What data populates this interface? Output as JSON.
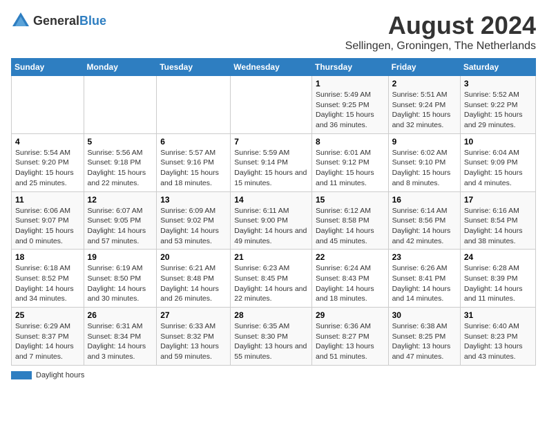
{
  "logo": {
    "general": "General",
    "blue": "Blue"
  },
  "title": "August 2024",
  "subtitle": "Sellingen, Groningen, The Netherlands",
  "days_of_week": [
    "Sunday",
    "Monday",
    "Tuesday",
    "Wednesday",
    "Thursday",
    "Friday",
    "Saturday"
  ],
  "weeks": [
    [
      {
        "num": "",
        "info": ""
      },
      {
        "num": "",
        "info": ""
      },
      {
        "num": "",
        "info": ""
      },
      {
        "num": "",
        "info": ""
      },
      {
        "num": "1",
        "info": "Sunrise: 5:49 AM\nSunset: 9:25 PM\nDaylight: 15 hours and 36 minutes."
      },
      {
        "num": "2",
        "info": "Sunrise: 5:51 AM\nSunset: 9:24 PM\nDaylight: 15 hours and 32 minutes."
      },
      {
        "num": "3",
        "info": "Sunrise: 5:52 AM\nSunset: 9:22 PM\nDaylight: 15 hours and 29 minutes."
      }
    ],
    [
      {
        "num": "4",
        "info": "Sunrise: 5:54 AM\nSunset: 9:20 PM\nDaylight: 15 hours and 25 minutes."
      },
      {
        "num": "5",
        "info": "Sunrise: 5:56 AM\nSunset: 9:18 PM\nDaylight: 15 hours and 22 minutes."
      },
      {
        "num": "6",
        "info": "Sunrise: 5:57 AM\nSunset: 9:16 PM\nDaylight: 15 hours and 18 minutes."
      },
      {
        "num": "7",
        "info": "Sunrise: 5:59 AM\nSunset: 9:14 PM\nDaylight: 15 hours and 15 minutes."
      },
      {
        "num": "8",
        "info": "Sunrise: 6:01 AM\nSunset: 9:12 PM\nDaylight: 15 hours and 11 minutes."
      },
      {
        "num": "9",
        "info": "Sunrise: 6:02 AM\nSunset: 9:10 PM\nDaylight: 15 hours and 8 minutes."
      },
      {
        "num": "10",
        "info": "Sunrise: 6:04 AM\nSunset: 9:09 PM\nDaylight: 15 hours and 4 minutes."
      }
    ],
    [
      {
        "num": "11",
        "info": "Sunrise: 6:06 AM\nSunset: 9:07 PM\nDaylight: 15 hours and 0 minutes."
      },
      {
        "num": "12",
        "info": "Sunrise: 6:07 AM\nSunset: 9:05 PM\nDaylight: 14 hours and 57 minutes."
      },
      {
        "num": "13",
        "info": "Sunrise: 6:09 AM\nSunset: 9:02 PM\nDaylight: 14 hours and 53 minutes."
      },
      {
        "num": "14",
        "info": "Sunrise: 6:11 AM\nSunset: 9:00 PM\nDaylight: 14 hours and 49 minutes."
      },
      {
        "num": "15",
        "info": "Sunrise: 6:12 AM\nSunset: 8:58 PM\nDaylight: 14 hours and 45 minutes."
      },
      {
        "num": "16",
        "info": "Sunrise: 6:14 AM\nSunset: 8:56 PM\nDaylight: 14 hours and 42 minutes."
      },
      {
        "num": "17",
        "info": "Sunrise: 6:16 AM\nSunset: 8:54 PM\nDaylight: 14 hours and 38 minutes."
      }
    ],
    [
      {
        "num": "18",
        "info": "Sunrise: 6:18 AM\nSunset: 8:52 PM\nDaylight: 14 hours and 34 minutes."
      },
      {
        "num": "19",
        "info": "Sunrise: 6:19 AM\nSunset: 8:50 PM\nDaylight: 14 hours and 30 minutes."
      },
      {
        "num": "20",
        "info": "Sunrise: 6:21 AM\nSunset: 8:48 PM\nDaylight: 14 hours and 26 minutes."
      },
      {
        "num": "21",
        "info": "Sunrise: 6:23 AM\nSunset: 8:45 PM\nDaylight: 14 hours and 22 minutes."
      },
      {
        "num": "22",
        "info": "Sunrise: 6:24 AM\nSunset: 8:43 PM\nDaylight: 14 hours and 18 minutes."
      },
      {
        "num": "23",
        "info": "Sunrise: 6:26 AM\nSunset: 8:41 PM\nDaylight: 14 hours and 14 minutes."
      },
      {
        "num": "24",
        "info": "Sunrise: 6:28 AM\nSunset: 8:39 PM\nDaylight: 14 hours and 11 minutes."
      }
    ],
    [
      {
        "num": "25",
        "info": "Sunrise: 6:29 AM\nSunset: 8:37 PM\nDaylight: 14 hours and 7 minutes."
      },
      {
        "num": "26",
        "info": "Sunrise: 6:31 AM\nSunset: 8:34 PM\nDaylight: 14 hours and 3 minutes."
      },
      {
        "num": "27",
        "info": "Sunrise: 6:33 AM\nSunset: 8:32 PM\nDaylight: 13 hours and 59 minutes."
      },
      {
        "num": "28",
        "info": "Sunrise: 6:35 AM\nSunset: 8:30 PM\nDaylight: 13 hours and 55 minutes."
      },
      {
        "num": "29",
        "info": "Sunrise: 6:36 AM\nSunset: 8:27 PM\nDaylight: 13 hours and 51 minutes."
      },
      {
        "num": "30",
        "info": "Sunrise: 6:38 AM\nSunset: 8:25 PM\nDaylight: 13 hours and 47 minutes."
      },
      {
        "num": "31",
        "info": "Sunrise: 6:40 AM\nSunset: 8:23 PM\nDaylight: 13 hours and 43 minutes."
      }
    ]
  ],
  "legend": {
    "label": "Daylight hours"
  }
}
